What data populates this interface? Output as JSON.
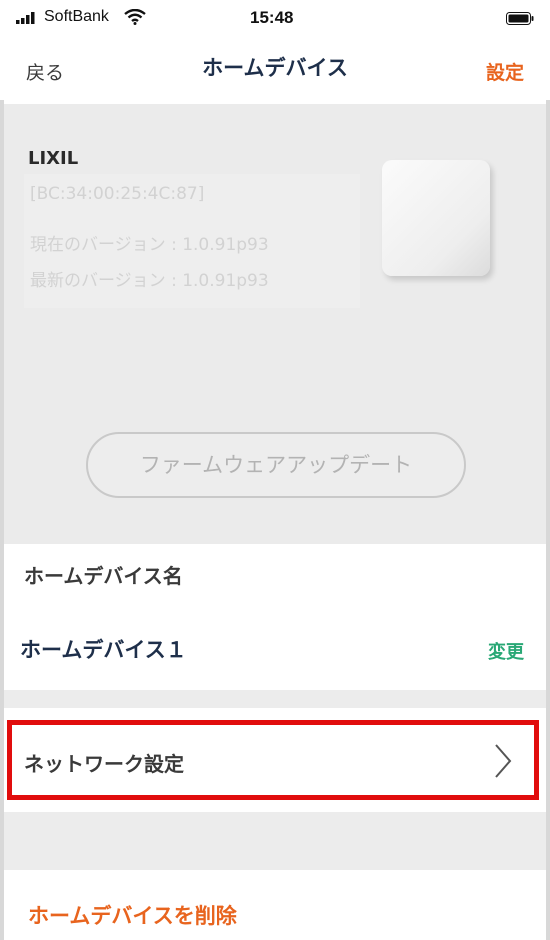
{
  "status_bar": {
    "carrier": "SoftBank",
    "time": "15:48"
  },
  "nav": {
    "back_label": "戻る",
    "title": "ホームデバイス",
    "settings_label": "設定"
  },
  "device": {
    "name": "LIXIL",
    "mac": "[BC:34:00:25:4C:87]",
    "current_version": "現在のバージョン : 1.0.91p93",
    "latest_version": "最新のバージョン : 1.0.91p93",
    "update_button_label": "ファームウェアアップデート"
  },
  "device_name_section": {
    "label": "ホームデバイス名",
    "value": "ホームデバイス１",
    "change_label": "変更"
  },
  "network": {
    "label": "ネットワーク設定"
  },
  "delete_label": "ホームデバイスを削除",
  "colors": {
    "accent_orange": "#e8641e",
    "accent_green": "#2aa876",
    "highlight_red": "#e10d0d",
    "title_navy": "#1e2f4a"
  }
}
